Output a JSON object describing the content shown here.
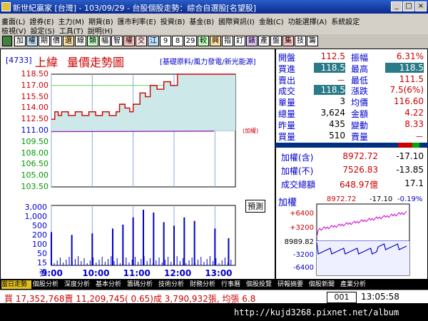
{
  "window": {
    "title": "新世紀贏家 [台灣] - 103/09/29 - 台股個股走勢：綜合自選股[名望股]"
  },
  "menu": {
    "row1": [
      "畫面(L)",
      "證券(E)",
      "主力(M)",
      "期貨(B)",
      "匯市利率(E)",
      "投資(B)",
      "基金(B)",
      "國際資訊(I)",
      "金融(C)",
      "功能選擇(A)",
      "系統設定"
    ],
    "row2": [
      "檢視(V)",
      "設定(S)",
      "工具(T)",
      "說明(H)"
    ]
  },
  "toolbar": {
    "buttons": [
      "加",
      "權",
      "期",
      "價",
      "選",
      "線",
      "類",
      "幅",
      "智",
      "權",
      "交",
      "江",
      "9",
      "8",
      "29",
      "較",
      "興",
      "指",
      "訂",
      "錶",
      "產",
      "盤",
      "集",
      "技",
      "籌"
    ]
  },
  "chart": {
    "code": "[4733]",
    "name": "上緯",
    "chart_title": "量價走勢圖",
    "sector": "[基礎原料/風力發電/新光能源]",
    "price_ticks": [
      "118.50",
      "117.00",
      "115.50",
      "114.00",
      "112.50",
      "111.00",
      "109.50",
      "108.00",
      "106.50",
      "105.00",
      "103.50"
    ],
    "volume_ticks": [
      "3,000",
      "1,000",
      "500",
      "200",
      "100",
      "50",
      "15",
      "張"
    ],
    "time_ticks": [
      "9:00",
      "10:00",
      "11:00",
      "12:00",
      "13:00"
    ],
    "side_note": "(加權)",
    "predict_label": "預測"
  },
  "chart_data": {
    "type": "line",
    "ylim": [
      103.5,
      118.5
    ],
    "ylabel": "",
    "prev_close": 111.0,
    "price": {
      "x": [
        "9:00",
        "9:05",
        "9:10",
        "9:15",
        "9:25",
        "9:35",
        "9:45",
        "9:55",
        "10:05",
        "10:15",
        "10:25",
        "10:35",
        "10:40",
        "10:48",
        "10:55",
        "11:00",
        "11:05",
        "11:10",
        "11:18",
        "11:25",
        "11:35",
        "11:45",
        "11:55",
        "12:05",
        "12:30",
        "13:00",
        "13:30"
      ],
      "y": [
        112.5,
        113.5,
        113.0,
        113.5,
        113.0,
        113.5,
        113.0,
        113.5,
        113.0,
        113.5,
        113.0,
        113.5,
        114.5,
        114.0,
        113.5,
        114.5,
        114.5,
        116.0,
        115.5,
        117.0,
        116.5,
        117.5,
        117.0,
        118.5,
        118.5,
        118.5,
        118.5
      ]
    },
    "volume": {
      "x": [
        "9:00",
        "9:30",
        "10:00",
        "10:30",
        "10:45",
        "11:00",
        "11:15",
        "11:30",
        "11:45",
        "12:00",
        "12:15",
        "12:30",
        "13:00",
        "13:20"
      ],
      "y": [
        120,
        80,
        100,
        200,
        350,
        1000,
        3000,
        2000,
        500,
        300,
        1000,
        600,
        200,
        50
      ]
    }
  },
  "quote": {
    "rows": [
      {
        "l1": "開盤",
        "v1": "112.5",
        "l2": "振幅",
        "v2": "6.31%"
      },
      {
        "l1": "買進",
        "v1": "118.5",
        "l2": "最高",
        "v2": "118.5"
      },
      {
        "l1": "賣出",
        "v1": "－",
        "l2": "最低",
        "v2": "111.5"
      },
      {
        "l1": "成交",
        "v1": "118.5",
        "l2": "漲跌",
        "v2": "7.5(6%)"
      },
      {
        "l1": "單量",
        "v1": "3",
        "l2": "均價",
        "v2": "116.60"
      },
      {
        "l1": "總量",
        "v1": "3,624",
        "l2": "金額",
        "v2": "4.22"
      },
      {
        "l1": "昨量",
        "v1": "435",
        "l2": "變動",
        "v2": "8.33"
      },
      {
        "l1": "買量",
        "v1": "510",
        "l2": "賣量",
        "v2": "－"
      }
    ],
    "index_rows": [
      {
        "label": "加權(含)",
        "value": "8972.72",
        "change": "-17.10"
      },
      {
        "label": "加權(不)",
        "value": "7526.83",
        "change": "-13.85"
      },
      {
        "label": "成交總額",
        "value": "648.97億",
        "change": "17.1"
      }
    ]
  },
  "mini": {
    "label": "加權",
    "value": "8972.72",
    "change": "-17.10",
    "pct": "-0.19%",
    "ticks": [
      "+6400",
      "+3200",
      "8989.82",
      "-3200",
      "-6400"
    ]
  },
  "tabs": [
    "當日走勢",
    "個股分析",
    "深度分析",
    "基本分析",
    "籌碼分析",
    "技術分析",
    "財務分析",
    "行事曆",
    "個股投覽",
    "研報摘要",
    "個股新聞",
    "產業分析"
  ],
  "status": {
    "text": "買 17,352,768賣 11,209,745( 0.65)成 3,790,932張, 均張 6.8",
    "code": "001",
    "time": "13:05:58"
  },
  "footer": {
    "url": "http://kujd3268.pixnet.net/album"
  }
}
